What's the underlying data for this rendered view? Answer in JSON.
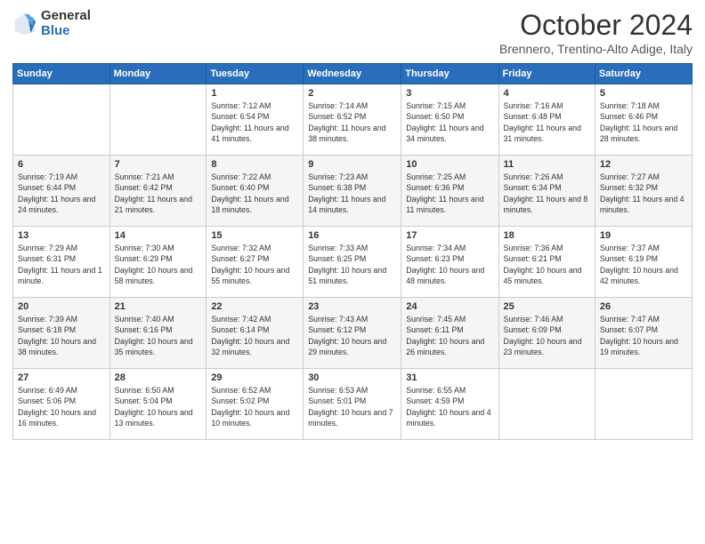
{
  "logo": {
    "general": "General",
    "blue": "Blue"
  },
  "header": {
    "month": "October 2024",
    "location": "Brennero, Trentino-Alto Adige, Italy"
  },
  "weekdays": [
    "Sunday",
    "Monday",
    "Tuesday",
    "Wednesday",
    "Thursday",
    "Friday",
    "Saturday"
  ],
  "weeks": [
    [
      {
        "day": "",
        "info": ""
      },
      {
        "day": "",
        "info": ""
      },
      {
        "day": "1",
        "info": "Sunrise: 7:12 AM\nSunset: 6:54 PM\nDaylight: 11 hours and 41 minutes."
      },
      {
        "day": "2",
        "info": "Sunrise: 7:14 AM\nSunset: 6:52 PM\nDaylight: 11 hours and 38 minutes."
      },
      {
        "day": "3",
        "info": "Sunrise: 7:15 AM\nSunset: 6:50 PM\nDaylight: 11 hours and 34 minutes."
      },
      {
        "day": "4",
        "info": "Sunrise: 7:16 AM\nSunset: 6:48 PM\nDaylight: 11 hours and 31 minutes."
      },
      {
        "day": "5",
        "info": "Sunrise: 7:18 AM\nSunset: 6:46 PM\nDaylight: 11 hours and 28 minutes."
      }
    ],
    [
      {
        "day": "6",
        "info": "Sunrise: 7:19 AM\nSunset: 6:44 PM\nDaylight: 11 hours and 24 minutes."
      },
      {
        "day": "7",
        "info": "Sunrise: 7:21 AM\nSunset: 6:42 PM\nDaylight: 11 hours and 21 minutes."
      },
      {
        "day": "8",
        "info": "Sunrise: 7:22 AM\nSunset: 6:40 PM\nDaylight: 11 hours and 18 minutes."
      },
      {
        "day": "9",
        "info": "Sunrise: 7:23 AM\nSunset: 6:38 PM\nDaylight: 11 hours and 14 minutes."
      },
      {
        "day": "10",
        "info": "Sunrise: 7:25 AM\nSunset: 6:36 PM\nDaylight: 11 hours and 11 minutes."
      },
      {
        "day": "11",
        "info": "Sunrise: 7:26 AM\nSunset: 6:34 PM\nDaylight: 11 hours and 8 minutes."
      },
      {
        "day": "12",
        "info": "Sunrise: 7:27 AM\nSunset: 6:32 PM\nDaylight: 11 hours and 4 minutes."
      }
    ],
    [
      {
        "day": "13",
        "info": "Sunrise: 7:29 AM\nSunset: 6:31 PM\nDaylight: 11 hours and 1 minute."
      },
      {
        "day": "14",
        "info": "Sunrise: 7:30 AM\nSunset: 6:29 PM\nDaylight: 10 hours and 58 minutes."
      },
      {
        "day": "15",
        "info": "Sunrise: 7:32 AM\nSunset: 6:27 PM\nDaylight: 10 hours and 55 minutes."
      },
      {
        "day": "16",
        "info": "Sunrise: 7:33 AM\nSunset: 6:25 PM\nDaylight: 10 hours and 51 minutes."
      },
      {
        "day": "17",
        "info": "Sunrise: 7:34 AM\nSunset: 6:23 PM\nDaylight: 10 hours and 48 minutes."
      },
      {
        "day": "18",
        "info": "Sunrise: 7:36 AM\nSunset: 6:21 PM\nDaylight: 10 hours and 45 minutes."
      },
      {
        "day": "19",
        "info": "Sunrise: 7:37 AM\nSunset: 6:19 PM\nDaylight: 10 hours and 42 minutes."
      }
    ],
    [
      {
        "day": "20",
        "info": "Sunrise: 7:39 AM\nSunset: 6:18 PM\nDaylight: 10 hours and 38 minutes."
      },
      {
        "day": "21",
        "info": "Sunrise: 7:40 AM\nSunset: 6:16 PM\nDaylight: 10 hours and 35 minutes."
      },
      {
        "day": "22",
        "info": "Sunrise: 7:42 AM\nSunset: 6:14 PM\nDaylight: 10 hours and 32 minutes."
      },
      {
        "day": "23",
        "info": "Sunrise: 7:43 AM\nSunset: 6:12 PM\nDaylight: 10 hours and 29 minutes."
      },
      {
        "day": "24",
        "info": "Sunrise: 7:45 AM\nSunset: 6:11 PM\nDaylight: 10 hours and 26 minutes."
      },
      {
        "day": "25",
        "info": "Sunrise: 7:46 AM\nSunset: 6:09 PM\nDaylight: 10 hours and 23 minutes."
      },
      {
        "day": "26",
        "info": "Sunrise: 7:47 AM\nSunset: 6:07 PM\nDaylight: 10 hours and 19 minutes."
      }
    ],
    [
      {
        "day": "27",
        "info": "Sunrise: 6:49 AM\nSunset: 5:06 PM\nDaylight: 10 hours and 16 minutes."
      },
      {
        "day": "28",
        "info": "Sunrise: 6:50 AM\nSunset: 5:04 PM\nDaylight: 10 hours and 13 minutes."
      },
      {
        "day": "29",
        "info": "Sunrise: 6:52 AM\nSunset: 5:02 PM\nDaylight: 10 hours and 10 minutes."
      },
      {
        "day": "30",
        "info": "Sunrise: 6:53 AM\nSunset: 5:01 PM\nDaylight: 10 hours and 7 minutes."
      },
      {
        "day": "31",
        "info": "Sunrise: 6:55 AM\nSunset: 4:59 PM\nDaylight: 10 hours and 4 minutes."
      },
      {
        "day": "",
        "info": ""
      },
      {
        "day": "",
        "info": ""
      }
    ]
  ]
}
